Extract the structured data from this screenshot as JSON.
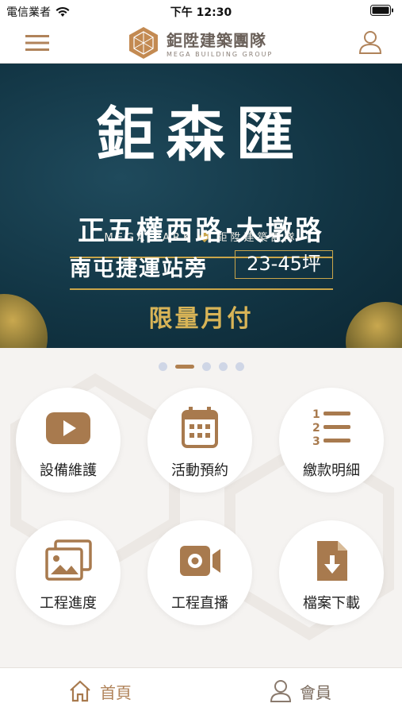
{
  "status_bar": {
    "carrier": "電信業者",
    "time": "下午 12:30"
  },
  "header": {
    "brand_name": "鉅陞建築團隊",
    "brand_sub": "MEGA BUILDING GROUP"
  },
  "banner": {
    "title": "鉅森匯",
    "subtitle_left": "MEGA PARK",
    "subtitle_right": "鉅陞建築團隊",
    "road": "正五權西路‧大墩路",
    "station": "南屯捷運站旁",
    "size": "23-45坪",
    "promo": "限量月付"
  },
  "carousel": {
    "total": 5,
    "active_index": 1
  },
  "features": [
    {
      "label": "設備維護",
      "icon": "video-play-icon"
    },
    {
      "label": "活動預約",
      "icon": "calendar-icon"
    },
    {
      "label": "繳款明細",
      "icon": "numbered-list-icon"
    },
    {
      "label": "工程進度",
      "icon": "gallery-icon"
    },
    {
      "label": "工程直播",
      "icon": "video-camera-icon"
    },
    {
      "label": "檔案下載",
      "icon": "file-download-icon"
    }
  ],
  "tabbar": {
    "home_label": "首頁",
    "member_label": "會員"
  },
  "colors": {
    "accent": "#b0835a",
    "banner_bg": "#123544",
    "gold": "#c9a54a"
  }
}
